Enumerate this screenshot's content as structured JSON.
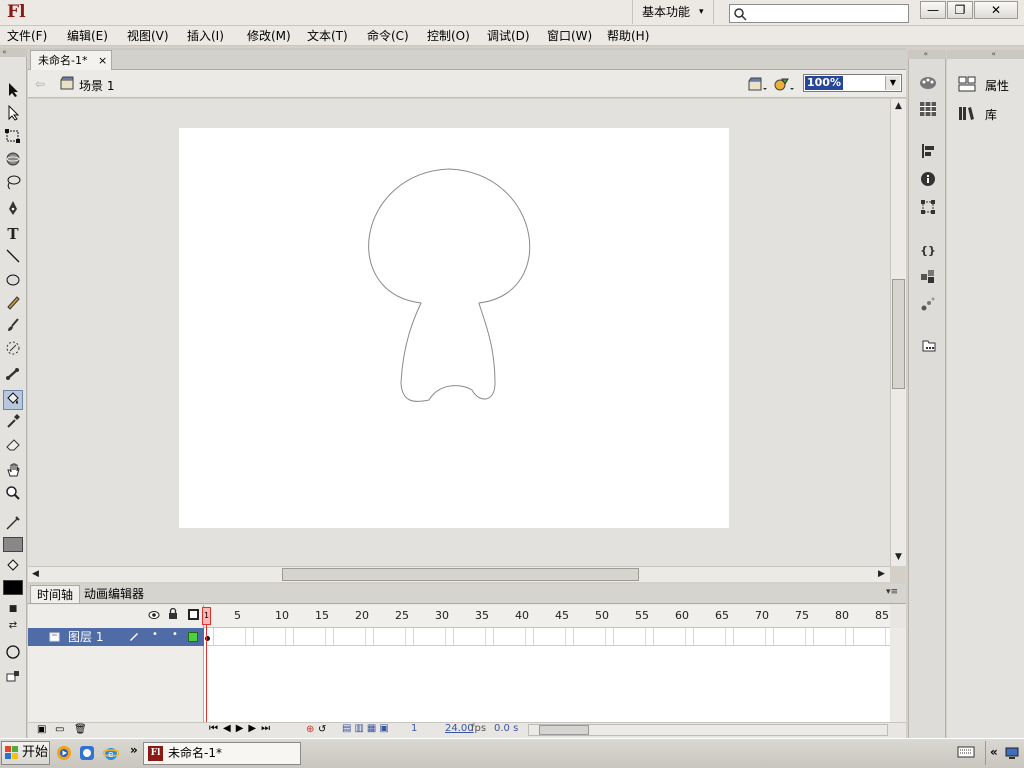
{
  "app": {
    "logo": "Fl"
  },
  "workspace": {
    "label": "基本功能",
    "arrow": "▾"
  },
  "search": {
    "placeholder": ""
  },
  "window_controls": {
    "minimize": "—",
    "restore": "❐",
    "close": "✕"
  },
  "menu": {
    "items": [
      "文件(F)",
      "编辑(E)",
      "视图(V)",
      "插入(I)",
      "修改(M)",
      "文本(T)",
      "命令(C)",
      "控制(O)",
      "调试(D)",
      "窗口(W)",
      "帮助(H)"
    ]
  },
  "document": {
    "tab_label": "未命名-1*",
    "tab_close": "×",
    "scene_label": "场景 1",
    "zoom": "100%"
  },
  "timeline": {
    "tabs": [
      "时间轴",
      "动画编辑器"
    ],
    "layer_name": "图层 1",
    "frame_numbers": [
      "1",
      "5",
      "10",
      "15",
      "20",
      "25",
      "30",
      "35",
      "40",
      "45",
      "50",
      "55",
      "60",
      "65",
      "70",
      "75",
      "80",
      "85"
    ],
    "current_frame": "1",
    "fps": "24.00",
    "fps_unit": "fps",
    "elapsed": "0.0 s"
  },
  "panels": {
    "properties": "属性",
    "library": "库"
  },
  "taskbar": {
    "start_label": "开始",
    "task_label": "未命名-1*"
  },
  "colors": {
    "accent_selection": "#506ca6",
    "playhead": "#dd3333",
    "logo": "#8a1a14"
  }
}
